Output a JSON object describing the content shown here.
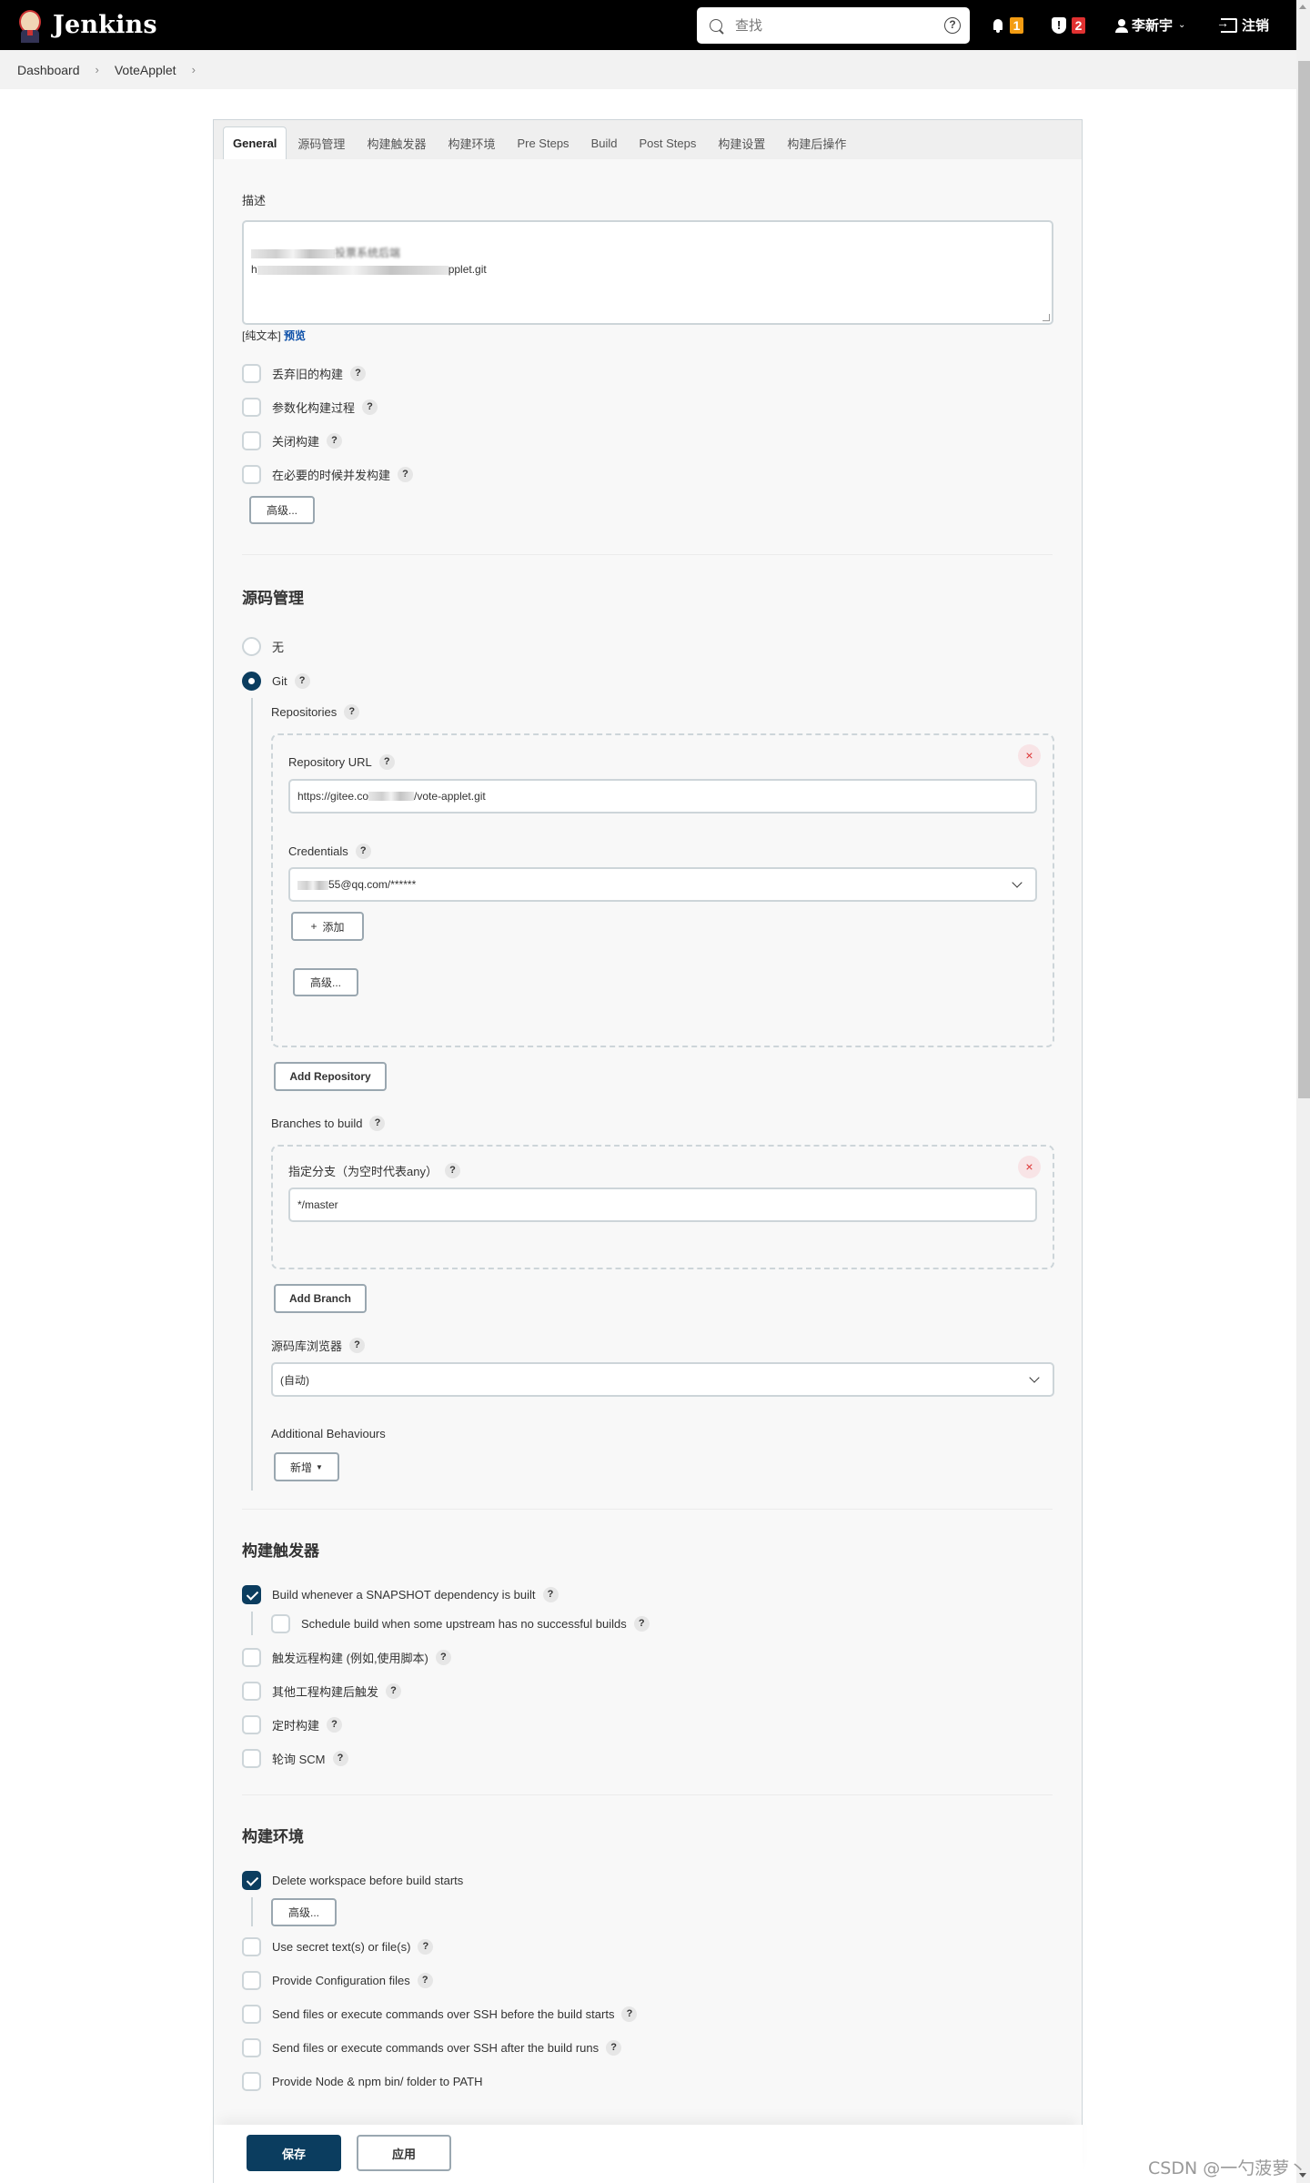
{
  "header": {
    "app_name": "Jenkins",
    "search_placeholder": "查找",
    "notifications_count": "1",
    "notifications_color": "#f39c12",
    "security_count": "2",
    "security_color": "#e03131",
    "user_name": "李新宇",
    "logout_label": "注销"
  },
  "breadcrumb": {
    "items": [
      "Dashboard",
      "VoteApplet"
    ]
  },
  "tabs": [
    {
      "label": "General",
      "active": true
    },
    {
      "label": "源码管理"
    },
    {
      "label": "构建触发器"
    },
    {
      "label": "构建环境"
    },
    {
      "label": "Pre Steps"
    },
    {
      "label": "Build"
    },
    {
      "label": "Post Steps"
    },
    {
      "label": "构建设置"
    },
    {
      "label": "构建后操作"
    }
  ],
  "general": {
    "description_label": "描述",
    "description_line1_suffix": "投票系统后端",
    "description_line2_prefix": "h",
    "description_line2_suffix": "pplet.git",
    "hint_plain": "[纯文本]",
    "hint_preview": "预览",
    "options": [
      {
        "label": "丢弃旧的构建",
        "checked": false
      },
      {
        "label": "参数化构建过程",
        "checked": false
      },
      {
        "label": "关闭构建",
        "checked": false
      },
      {
        "label": "在必要的时候并发构建",
        "checked": false
      }
    ],
    "advanced_label": "高级..."
  },
  "scm": {
    "title": "源码管理",
    "none_label": "无",
    "git_label": "Git",
    "selected": "Git",
    "repositories_label": "Repositories",
    "repo_url_label": "Repository URL",
    "repo_url_prefix": "https://gitee.co",
    "repo_url_suffix": "/vote-applet.git",
    "credentials_label": "Credentials",
    "credentials_value_suffix": "55@qq.com/******",
    "add_label": "添加",
    "advanced_label": "高级...",
    "add_repository_label": "Add Repository",
    "branches_label": "Branches to build",
    "branch_spec_label": "指定分支（为空时代表any）",
    "branch_spec_value": "*/master",
    "add_branch_label": "Add Branch",
    "browser_label": "源码库浏览器",
    "browser_value": "(自动)",
    "additional_label": "Additional Behaviours",
    "new_label": "新增"
  },
  "triggers": {
    "title": "构建触发器",
    "snapshot": {
      "label": "Build whenever a SNAPSHOT dependency is built",
      "checked": true
    },
    "schedule_upstream": {
      "label": "Schedule build when some upstream has no successful builds",
      "checked": false
    },
    "options": [
      {
        "label": "触发远程构建 (例如,使用脚本)",
        "checked": false
      },
      {
        "label": "其他工程构建后触发",
        "checked": false
      },
      {
        "label": "定时构建",
        "checked": false
      },
      {
        "label": "轮询 SCM",
        "checked": false
      }
    ]
  },
  "build_env": {
    "title": "构建环境",
    "delete_ws": {
      "label": "Delete workspace before build starts",
      "checked": true
    },
    "advanced_label": "高级...",
    "options": [
      {
        "label": "Use secret text(s) or file(s)",
        "checked": false,
        "help": true
      },
      {
        "label": "Provide Configuration files",
        "checked": false,
        "help": true
      },
      {
        "label": "Send files or execute commands over SSH before the build starts",
        "checked": false,
        "help": true
      },
      {
        "label": "Send files or execute commands over SSH after the build runs",
        "checked": false,
        "help": true
      },
      {
        "label": "Provide Node & npm bin/ folder to PATH",
        "checked": false,
        "help": false
      }
    ]
  },
  "footer": {
    "save_label": "保存",
    "apply_label": "应用"
  },
  "watermark": "CSDN @一勺菠萝丶"
}
